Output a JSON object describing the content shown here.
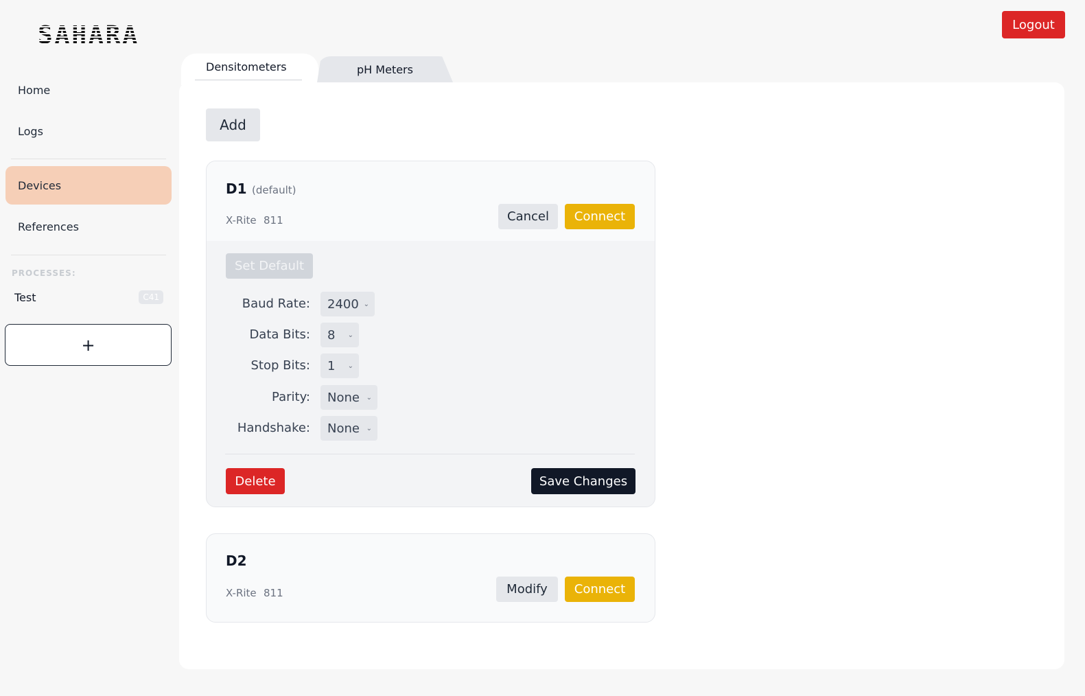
{
  "brand": {
    "logo_text": "SAHARA"
  },
  "header": {
    "logout_label": "Logout"
  },
  "sidebar": {
    "items": [
      {
        "label": "Home",
        "active": false
      },
      {
        "label": "Logs",
        "active": false
      },
      {
        "label": "Devices",
        "active": true
      },
      {
        "label": "References",
        "active": false
      }
    ],
    "processes_label": "PROCESSES:",
    "processes": [
      {
        "name": "Test",
        "badge": "C41"
      }
    ],
    "add_process_label": "+"
  },
  "tabs": [
    {
      "label": "Densitometers",
      "active": true
    },
    {
      "label": "pH Meters",
      "active": false
    }
  ],
  "main": {
    "add_label": "Add",
    "devices": [
      {
        "name": "D1",
        "tag": "(default)",
        "brand": "X-Rite",
        "model": "811",
        "cancel_label": "Cancel",
        "connect_label": "Connect",
        "set_default_label": "Set Default",
        "fields": [
          {
            "label": "Baud Rate:",
            "value": "2400"
          },
          {
            "label": "Data Bits:",
            "value": "8"
          },
          {
            "label": "Stop Bits:",
            "value": "1"
          },
          {
            "label": "Parity:",
            "value": "None"
          },
          {
            "label": "Handshake:",
            "value": "None"
          }
        ],
        "delete_label": "Delete",
        "save_label": "Save Changes"
      },
      {
        "name": "D2",
        "brand": "X-Rite",
        "model": "811",
        "modify_label": "Modify",
        "connect_label": "Connect"
      }
    ]
  },
  "colors": {
    "accent_active": "#f6cfb7",
    "danger": "#dc2626",
    "connect": "#eab308",
    "primary_dark": "#111827"
  }
}
